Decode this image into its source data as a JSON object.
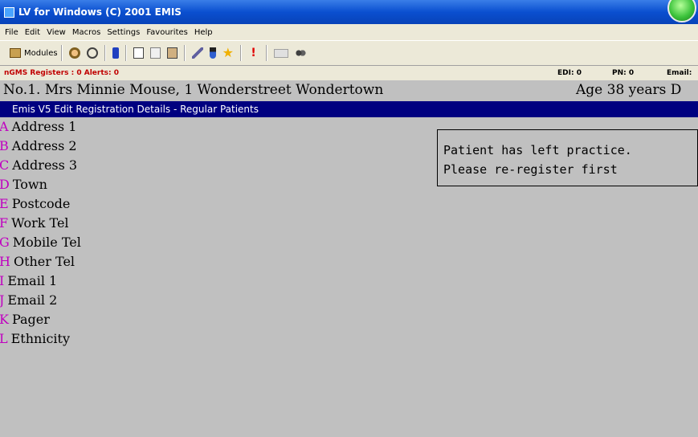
{
  "window": {
    "title": "LV for Windows (C) 2001 EMIS"
  },
  "menu": {
    "items": [
      "File",
      "Edit",
      "View",
      "Macros",
      "Settings",
      "Favourites",
      "Help"
    ]
  },
  "toolbar": {
    "modules_label": "Modules"
  },
  "status": {
    "registers": "nGMS Registers : 0  Alerts: 0",
    "edi": "EDI: 0",
    "pn": "PN: 0",
    "email": "Email:"
  },
  "patient": {
    "line": "No.1. Mrs Minnie Mouse, 1 Wonderstreet Wondertown",
    "age": "Age 38 years D"
  },
  "screen": {
    "header": "Emis V5 Edit Registration Details - Regular Patients"
  },
  "fields": [
    {
      "key": "A",
      "label": "Address 1"
    },
    {
      "key": "B",
      "label": "Address 2"
    },
    {
      "key": "C",
      "label": "Address 3"
    },
    {
      "key": "D",
      "label": "Town"
    },
    {
      "key": "E",
      "label": "Postcode"
    },
    {
      "key": "F",
      "label": "Work Tel"
    },
    {
      "key": "G",
      "label": "Mobile Tel"
    },
    {
      "key": "H",
      "label": "Other Tel"
    },
    {
      "key": "I",
      "label": "Email 1"
    },
    {
      "key": "J",
      "label": "Email 2"
    },
    {
      "key": "K",
      "label": "Pager"
    },
    {
      "key": "L",
      "label": "Ethnicity"
    }
  ],
  "message": {
    "line1": "Patient has left practice.",
    "line2": "Please re-register first"
  },
  "colors": {
    "titlebar": "#0a4fd0",
    "header": "#000080",
    "key_letter": "#c000c0",
    "alert_text": "#c00000",
    "background": "#c0c0c0"
  }
}
